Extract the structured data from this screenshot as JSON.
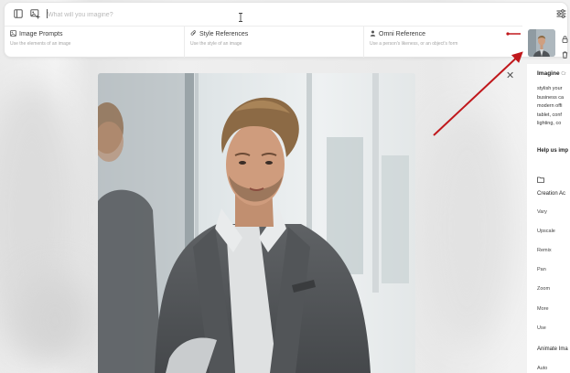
{
  "prompt_bar": {
    "placeholder": "What will you imagine?",
    "icons": [
      "image-panel-icon",
      "image-add-icon",
      "sliders-icon"
    ]
  },
  "references": [
    {
      "title": "Image Prompts",
      "subtitle": "Use the elements of an image",
      "icon": "image-icon"
    },
    {
      "title": "Style References",
      "subtitle": "Use the style of an image",
      "icon": "paperclip-icon"
    },
    {
      "title": "Omni Reference",
      "subtitle": "Use a person's likeness, or an object's form",
      "icon": "person-icon"
    }
  ],
  "right_panel": {
    "title": "Imagine",
    "title_suffix": "Cr",
    "prompt_lines": [
      "stylish your",
      "business ca",
      "modern offi",
      "tablet, conf",
      "lighting, co"
    ],
    "help_label": "Help us imp",
    "creation_actions_label": "Creation Ac",
    "actions": [
      "Vary",
      "Upscale",
      "Remix",
      "Pan",
      "Zoom",
      "More",
      "Use"
    ],
    "animate_label": "Animate Ima",
    "auto_label": "Auto"
  },
  "colors": {
    "annotation_arrow": "#c0181c",
    "panel_bg": "#ffffff",
    "muted_text": "#a5a5a5"
  }
}
